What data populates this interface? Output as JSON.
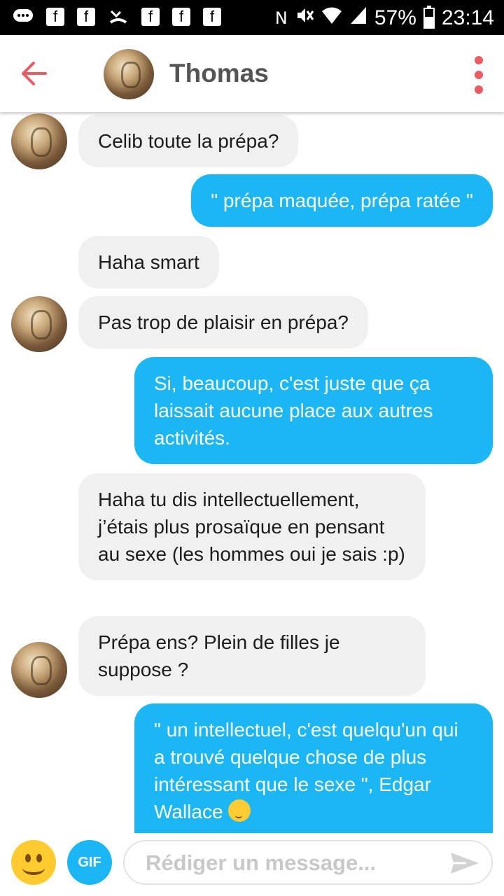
{
  "status_bar": {
    "battery": "57%",
    "time": "23:14",
    "battery_level": 0.57,
    "left_icons": [
      "chat-bubble-icon",
      "facebook-icon",
      "facebook-icon",
      "missed-call-icon",
      "facebook-icon",
      "facebook-icon",
      "facebook-icon"
    ],
    "right_icons": [
      "nfc-icon",
      "mute-icon",
      "wifi-icon",
      "signal-icon"
    ]
  },
  "header": {
    "contact_name": "Thomas"
  },
  "messages": [
    {
      "sender": "them",
      "text": "Celib toute la prépa?",
      "avatar": true
    },
    {
      "sender": "me",
      "text": "\" prépa maquée, prépa ratée \""
    },
    {
      "sender": "them",
      "text": "Haha smart",
      "avatar": false
    },
    {
      "sender": "them",
      "text": "Pas trop de plaisir en prépa?",
      "avatar": true
    },
    {
      "sender": "me",
      "text": "Si, beaucoup, c'est juste que ça laissait aucune place aux autres activités."
    },
    {
      "sender": "them",
      "text": "Haha tu dis intellectuellement, j’étais plus prosaïque en pensant au sexe (les hommes oui je sais :p)",
      "avatar": false
    },
    {
      "sender": "them",
      "text": "Prépa ens? Plein de filles je suppose ?",
      "avatar": true
    },
    {
      "sender": "me",
      "text": "\" un intellectuel, c'est quelqu'un qui a trouvé quelque chose de plus intéressant que le sexe \", Edgar Wallace",
      "emoji": "smiling-face-icon"
    }
  ],
  "composer": {
    "placeholder": "Rédiger un message...",
    "gif_label": "GIF"
  },
  "colors": {
    "accent": "#ea5b63",
    "outgoing_bubble": "#1ab7f4",
    "incoming_bubble": "#f0f0f0"
  }
}
